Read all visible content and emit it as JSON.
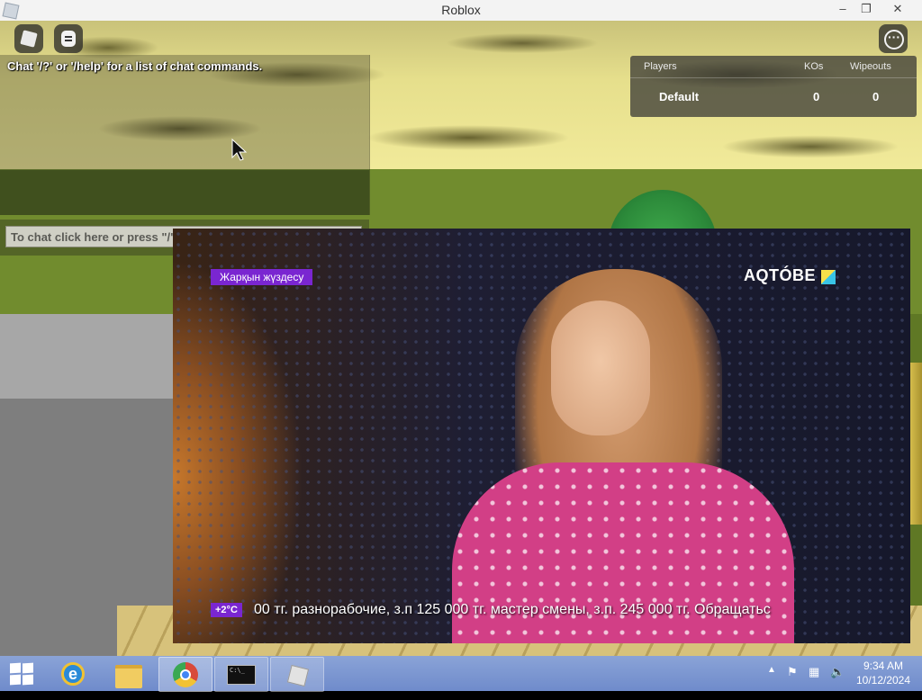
{
  "window": {
    "title": "Roblox",
    "controls": {
      "minimize": "–",
      "maximize": "❐",
      "close": "✕"
    }
  },
  "game": {
    "chat": {
      "system_message": "Chat '/?' or '/help' for a list of chat commands.",
      "input_placeholder": "To chat click here or press \"/\" key"
    },
    "playerlist": {
      "headers": {
        "players": "Players",
        "kos": "KOs",
        "wipeouts": "Wipeouts"
      },
      "rows": [
        {
          "name": "Default",
          "kos": "0",
          "wipeouts": "0"
        }
      ]
    },
    "icons": {
      "menu": "roblox-logo-icon",
      "chat": "chat-icon",
      "more": "more-options-icon"
    }
  },
  "video": {
    "program_tag": "Жарқын жүздесу",
    "channel_brand": "AQTÓBE",
    "temperature": "+2°C",
    "ticker": "00 тг. разнорабочие, з.п 125 000 тг. мастер смены, з.п. 245 000 тг. Обращатьс"
  },
  "taskbar": {
    "items": [
      "internet-explorer",
      "file-explorer",
      "chrome",
      "command-prompt",
      "roblox"
    ],
    "cmd_preview": "C:\\_",
    "clock": {
      "time": "9:34 AM",
      "date": "10/12/2024"
    }
  }
}
